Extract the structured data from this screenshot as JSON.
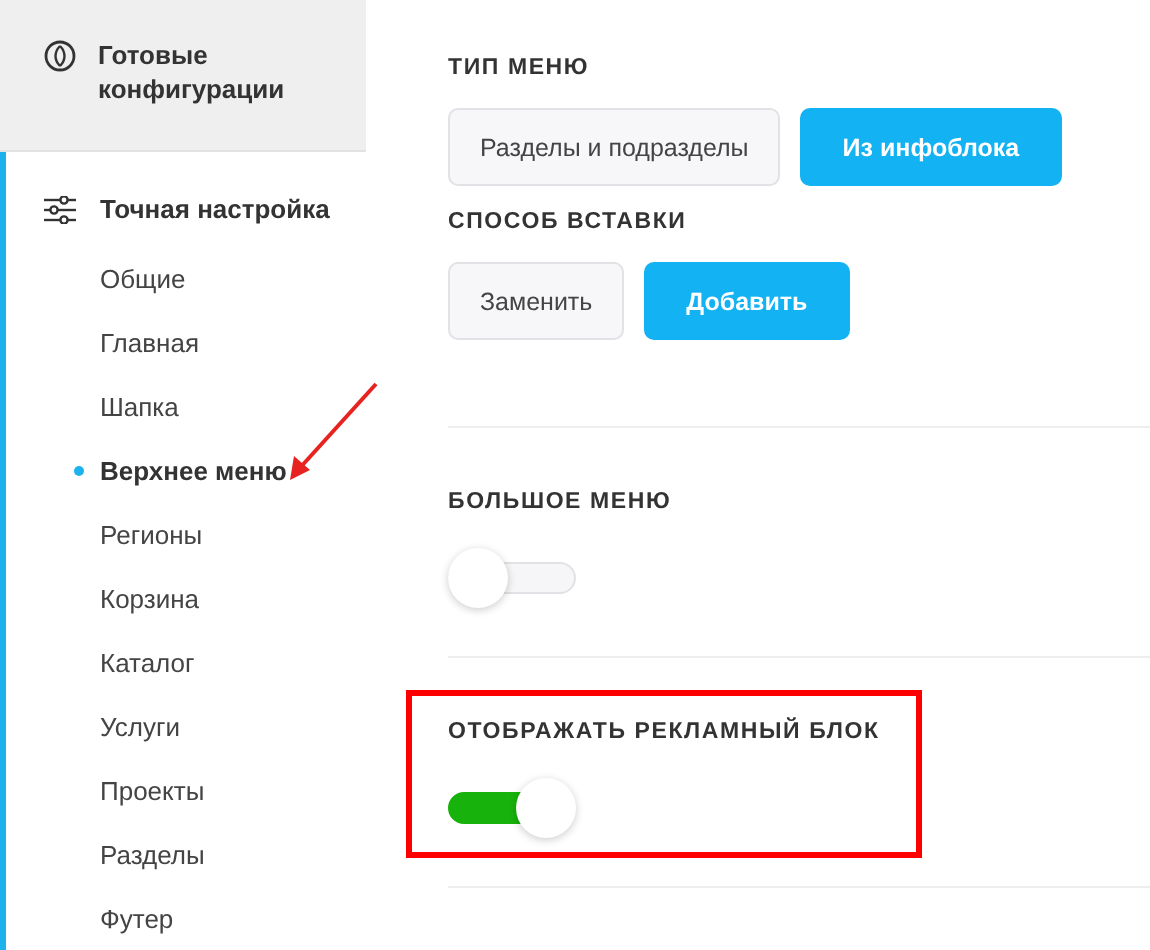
{
  "sidebar": {
    "top_item": {
      "label": "Готовые конфигурации"
    },
    "section": {
      "label": "Точная настройка",
      "items": [
        {
          "label": "Общие",
          "selected": false,
          "arrow": false
        },
        {
          "label": "Главная",
          "selected": false,
          "arrow": false
        },
        {
          "label": "Шапка",
          "selected": false,
          "arrow": false
        },
        {
          "label": "Верхнее меню",
          "selected": true,
          "arrow": true
        },
        {
          "label": "Регионы",
          "selected": false,
          "arrow": false
        },
        {
          "label": "Корзина",
          "selected": false,
          "arrow": false
        },
        {
          "label": "Каталог",
          "selected": false,
          "arrow": false
        },
        {
          "label": "Услуги",
          "selected": false,
          "arrow": false
        },
        {
          "label": "Проекты",
          "selected": false,
          "arrow": false
        },
        {
          "label": "Разделы",
          "selected": false,
          "arrow": false
        },
        {
          "label": "Футер",
          "selected": false,
          "arrow": false
        }
      ]
    }
  },
  "settings": [
    {
      "kind": "choice",
      "title": "ТИП МЕНЮ",
      "options": [
        {
          "label": "Разделы и подразделы",
          "selected": false
        },
        {
          "label": "Из инфоблока",
          "selected": true
        }
      ]
    },
    {
      "kind": "choice",
      "title": "СПОСОБ ВСТАВКИ",
      "options": [
        {
          "label": "Заменить",
          "selected": false
        },
        {
          "label": "Добавить",
          "selected": true
        }
      ]
    },
    {
      "kind": "toggle",
      "title": "БОЛЬШОЕ МЕНЮ",
      "on": false,
      "highlighted": false
    },
    {
      "kind": "toggle",
      "title": "ОТОБРАЖАТЬ РЕКЛАМНЫЙ БЛОК",
      "on": true,
      "highlighted": true
    }
  ]
}
